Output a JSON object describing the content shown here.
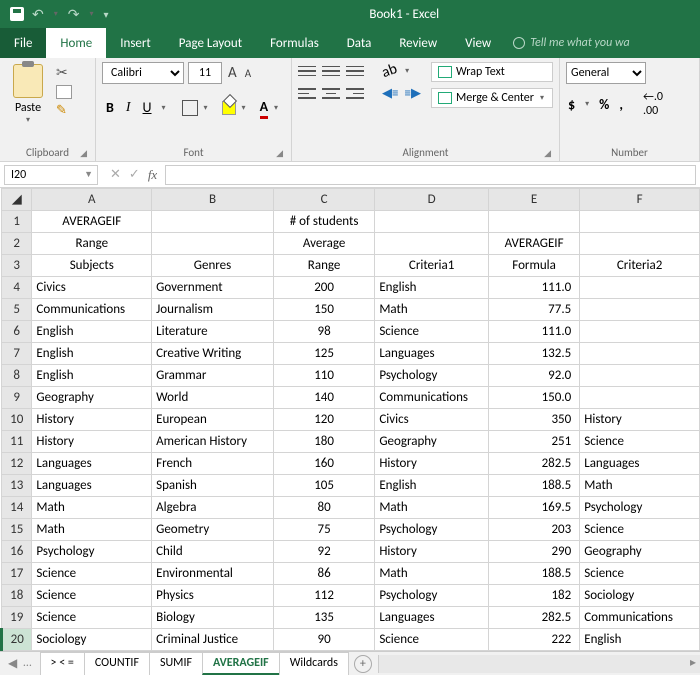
{
  "window": {
    "title": "Book1 - Excel"
  },
  "tabs": {
    "file": "File",
    "home": "Home",
    "insert": "Insert",
    "page_layout": "Page Layout",
    "formulas": "Formulas",
    "data": "Data",
    "review": "Review",
    "view": "View",
    "tell_me": "Tell me what you wa"
  },
  "ribbon": {
    "clipboard": {
      "paste": "Paste",
      "label": "Clipboard"
    },
    "font": {
      "name": "Calibri",
      "size": "11",
      "label": "Font",
      "bold": "B",
      "italic": "I",
      "underline": "U",
      "increase": "A",
      "decrease": "A",
      "font_color_letter": "A"
    },
    "alignment": {
      "label": "Alignment",
      "wrap": "Wrap Text",
      "merge": "Merge & Center"
    },
    "number": {
      "label": "Number",
      "format": "General",
      "currency": "$",
      "percent": "%",
      "comma": ",",
      "inc_dec": ".0",
      "dec_dec": ".00"
    }
  },
  "namebox": "I20",
  "formula": "",
  "columns": [
    "A",
    "B",
    "C",
    "D",
    "E",
    "F"
  ],
  "rows": [
    {
      "n": "1",
      "cells": [
        "AVERAGEIF",
        "",
        "# of students",
        "",
        "",
        ""
      ]
    },
    {
      "n": "2",
      "cells": [
        "Range",
        "",
        "Average",
        "",
        "AVERAGEIF",
        ""
      ]
    },
    {
      "n": "3",
      "cells": [
        "Subjects",
        "Genres",
        "Range",
        "Criteria1",
        "Formula",
        "Criteria2"
      ]
    },
    {
      "n": "4",
      "cells": [
        "Civics",
        "Government",
        "200",
        "English",
        "111.0",
        ""
      ]
    },
    {
      "n": "5",
      "cells": [
        "Communications",
        "Journalism",
        "150",
        "Math",
        "77.5",
        ""
      ]
    },
    {
      "n": "6",
      "cells": [
        "English",
        "Literature",
        "98",
        "Science",
        "111.0",
        ""
      ]
    },
    {
      "n": "7",
      "cells": [
        "English",
        "Creative Writing",
        "125",
        "Languages",
        "132.5",
        ""
      ]
    },
    {
      "n": "8",
      "cells": [
        "English",
        "Grammar",
        "110",
        "Psychology",
        "92.0",
        ""
      ]
    },
    {
      "n": "9",
      "cells": [
        "Geography",
        "World",
        "140",
        "Communications",
        "150.0",
        ""
      ]
    },
    {
      "n": "10",
      "cells": [
        "History",
        "European",
        "120",
        "Civics",
        "350",
        "History"
      ]
    },
    {
      "n": "11",
      "cells": [
        "History",
        "American History",
        "180",
        "Geography",
        "251",
        "Science"
      ]
    },
    {
      "n": "12",
      "cells": [
        "Languages",
        "French",
        "160",
        "History",
        "282.5",
        "Languages"
      ]
    },
    {
      "n": "13",
      "cells": [
        "Languages",
        "Spanish",
        "105",
        "English",
        "188.5",
        "Math"
      ]
    },
    {
      "n": "14",
      "cells": [
        "Math",
        "Algebra",
        "80",
        "Math",
        "169.5",
        "Psychology"
      ]
    },
    {
      "n": "15",
      "cells": [
        "Math",
        "Geometry",
        "75",
        "Psychology",
        "203",
        "Science"
      ]
    },
    {
      "n": "16",
      "cells": [
        "Psychology",
        "Child",
        "92",
        "History",
        "290",
        "Geography"
      ]
    },
    {
      "n": "17",
      "cells": [
        "Science",
        "Environmental",
        "86",
        "Math",
        "188.5",
        "Science"
      ]
    },
    {
      "n": "18",
      "cells": [
        "Science",
        "Physics",
        "112",
        "Psychology",
        "182",
        "Sociology"
      ]
    },
    {
      "n": "19",
      "cells": [
        "Science",
        "Biology",
        "135",
        "Languages",
        "282.5",
        "Communications"
      ]
    },
    {
      "n": "20",
      "cells": [
        "Sociology",
        "Criminal Justice",
        "90",
        "Science",
        "222",
        "English"
      ]
    }
  ],
  "col_align": [
    "left",
    "left",
    "center",
    "left",
    "right",
    "left"
  ],
  "header_center_rows": [
    "1",
    "2",
    "3"
  ],
  "sheets": {
    "nav_dots": "…",
    "tabs": [
      "> < =",
      "COUNTIF",
      "SUMIF",
      "AVERAGEIF",
      "Wildcards"
    ],
    "active": "AVERAGEIF",
    "new": "+"
  }
}
